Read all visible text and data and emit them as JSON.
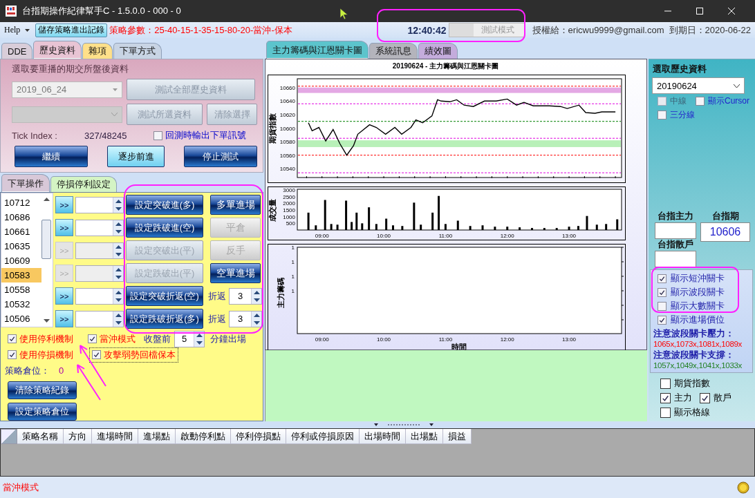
{
  "window": {
    "title": "台指期操作紀律幫手C - 1.5.0.0 - 000 - 0"
  },
  "toolbar": {
    "help_menu": "Help",
    "save_button": "儲存策略進出記錄",
    "strategy_params": "策略參數：25-40-15-1-35-15-80-20-當沖-保本",
    "clock": "12:40:42",
    "mode_button": "測試模式",
    "license": "授權給：ericwu9999@gmail.com",
    "expiry": "到期日：2020-06-22"
  },
  "left_tabs": [
    {
      "label": "DDE",
      "selected": false,
      "color": "#d9cdd9"
    },
    {
      "label": "歷史資料",
      "selected": true,
      "color": "#e8c4d4"
    },
    {
      "label": "雜項",
      "selected": false,
      "color": "#ffe08a"
    },
    {
      "label": "下單方式",
      "selected": false,
      "color": "#c8d4e4"
    }
  ],
  "history_panel": {
    "heading": "選取要重播的期交所盤後資料",
    "date_select": {
      "value": "2019_06_24",
      "disabled": true
    },
    "second_select": {
      "disabled": true
    },
    "buttons": [
      {
        "label": "測試全部歷史資料",
        "disabled": true
      },
      {
        "label": "測試所選資料",
        "disabled": true
      },
      {
        "label": "清除選擇",
        "disabled": true
      }
    ],
    "tick_index_label": "Tick Index :",
    "tick_index_value": "327/48245",
    "output_signal": {
      "label": "回測時輸出下單訊號",
      "checked": false
    },
    "actions": [
      {
        "label": "繼續",
        "kind": "dark"
      },
      {
        "label": "逐步前進",
        "kind": "light"
      },
      {
        "label": "停止測試",
        "kind": "dark"
      }
    ]
  },
  "order_tabs": [
    {
      "label": "下單操作",
      "selected": true,
      "color": "#d8c8d8"
    },
    {
      "label": "停損停利設定",
      "selected": false,
      "color": "#d4f4c4"
    }
  ],
  "price_list": [
    {
      "label": "10712",
      "selected": false
    },
    {
      "label": "10686",
      "selected": false
    },
    {
      "label": "10661",
      "selected": false
    },
    {
      "label": "10635",
      "selected": false
    },
    {
      "label": "10609",
      "selected": false
    },
    {
      "label": "10583",
      "selected": true
    },
    {
      "label": "10558",
      "selected": false
    },
    {
      "label": "10532",
      "selected": false
    },
    {
      "label": "10506",
      "selected": false
    }
  ],
  "order_rows": [
    {
      "arrow": ">>",
      "enabled": true,
      "action": {
        "label": "設定突破進(多)",
        "disabled": false
      },
      "side": {
        "kind": "button",
        "label": "多單進場",
        "disabled": false
      }
    },
    {
      "arrow": ">>",
      "enabled": true,
      "action": {
        "label": "設定跌破進(空)",
        "disabled": false
      },
      "side": {
        "kind": "button",
        "label": "平倉",
        "disabled": true
      }
    },
    {
      "arrow": ">>",
      "enabled": false,
      "action": {
        "label": "設定突破出(平)",
        "disabled": true
      },
      "side": {
        "kind": "button",
        "label": "反手",
        "disabled": true
      }
    },
    {
      "arrow": ">>",
      "enabled": false,
      "action": {
        "label": "設定跌破出(平)",
        "disabled": true
      },
      "side": {
        "kind": "button",
        "label": "空單進場",
        "disabled": false
      }
    },
    {
      "arrow": ">>",
      "enabled": true,
      "action": {
        "label": "設定突破折返(空)",
        "disabled": false
      },
      "side": {
        "kind": "spin",
        "label": "折返",
        "value": "3"
      }
    },
    {
      "arrow": ">>",
      "enabled": true,
      "action": {
        "label": "設定跌破折返(多)",
        "disabled": false
      },
      "side": {
        "kind": "spin",
        "label": "折返",
        "value": "3"
      }
    }
  ],
  "options": [
    {
      "label": "使用停利機制",
      "checked": true
    },
    {
      "label": "當沖模式",
      "checked": true
    },
    {
      "label": "使用停損機制",
      "checked": true
    },
    {
      "label": "攻擊弱勢回檔保本",
      "checked": true
    }
  ],
  "close_exit": {
    "before": "收盤前",
    "value": "5",
    "after": "分鐘出場"
  },
  "position": {
    "label": "策略倉位：",
    "value": "0"
  },
  "strategy_buttons": [
    "清除策略紀錄",
    "設定策略倉位"
  ],
  "chart_tabs": [
    {
      "label": "主力籌碼與江恩關卡圖",
      "selected": true,
      "color": "#5cc4cc"
    },
    {
      "label": "系統訊息",
      "selected": false,
      "color": "#b4b4bc"
    },
    {
      "label": "績效圖",
      "selected": false,
      "color": "#c4acdc"
    }
  ],
  "chart_panel": {
    "title": "20190624 - 主力籌碼與江恩關卡圖",
    "price_chart": {
      "chart_data": {
        "type": "line",
        "ylabel": "期貨指數",
        "xlim": [
          8.6,
          13.85
        ],
        "ylim": [
          10525,
          10671
        ],
        "yticks": [
          10540,
          10560,
          10580,
          10600,
          10620,
          10640,
          10660
        ],
        "x": [
          8.78,
          8.84,
          8.95,
          9.06,
          9.18,
          9.29,
          9.4,
          9.51,
          9.58,
          9.77,
          9.88,
          10.03,
          10.18,
          10.29,
          10.44,
          10.52,
          10.63,
          10.78,
          10.87,
          10.93,
          11.07,
          11.18,
          11.3,
          11.45,
          11.63,
          11.82,
          12.0,
          12.15,
          12.27,
          12.42,
          12.68,
          12.86,
          12.97,
          13.16,
          13.27,
          13.42,
          13.53,
          13.75
        ],
        "series": [
          {
            "color": "#000000",
            "values": [
              10606,
              10594,
              10599,
              10579,
              10596,
              10575,
              10558,
              10572,
              10589,
              10603,
              10599,
              10589,
              10599,
              10589,
              10599,
              10610,
              10606,
              10616,
              10640,
              10638,
              10637,
              10640,
              10632,
              10630,
              10638,
              10638,
              10641,
              10632,
              10636,
              10631,
              10631,
              10630,
              10627,
              10632,
              10621,
              10620,
              10622,
              10622
            ]
          }
        ],
        "bands": [
          {
            "axis": "y",
            "from": 10650,
            "to": 10658,
            "color": "#e4a8e4"
          },
          {
            "axis": "y",
            "from": 10570,
            "to": 10580,
            "color": "#b8f0b8"
          }
        ],
        "ref_lines": [
          {
            "axis": "y",
            "value": 10660,
            "color": "#ff0000"
          },
          {
            "axis": "y",
            "value": 10634,
            "color": "#e000e0"
          },
          {
            "axis": "y",
            "value": 10608,
            "color": "#008000"
          },
          {
            "axis": "y",
            "value": 10583,
            "color": "#e000e0"
          },
          {
            "axis": "y",
            "value": 10558,
            "color": "#ff0000"
          },
          {
            "axis": "y",
            "value": 10532,
            "color": "#e000e0"
          }
        ]
      }
    },
    "volume_chart": {
      "chart_data": {
        "type": "bar",
        "ylabel": "成交量",
        "xlim": [
          8.6,
          13.85
        ],
        "ylim": [
          0,
          3000
        ],
        "yticks": [
          500,
          1000,
          1500,
          2000,
          2500,
          3000
        ],
        "xticks": [
          {
            "value": 9,
            "label": "09:00"
          },
          {
            "value": 10,
            "label": "10:00"
          },
          {
            "value": 11,
            "label": "11:00"
          },
          {
            "value": 12,
            "label": "12:00"
          },
          {
            "value": 13,
            "label": "13:00"
          }
        ],
        "x": [
          8.78,
          8.9,
          9.05,
          9.15,
          9.25,
          9.39,
          9.48,
          9.56,
          9.65,
          9.76,
          9.88,
          10.04,
          10.15,
          10.3,
          10.49,
          10.6,
          10.79,
          10.89,
          11.0,
          11.2,
          11.4,
          11.6,
          11.8,
          12.0,
          12.2,
          12.4,
          12.6,
          12.8,
          13.0,
          13.15,
          13.29,
          13.45,
          13.6,
          13.78
        ],
        "values": [
          1300,
          350,
          2250,
          450,
          400,
          2200,
          600,
          1300,
          500,
          1700,
          450,
          850,
          350,
          300,
          2050,
          400,
          1300,
          2550,
          450,
          700,
          300,
          350,
          250,
          250,
          200,
          150,
          150,
          150,
          250,
          300,
          1050,
          400,
          450,
          800
        ]
      }
    },
    "chip_chart": {
      "ylabel": "主力籌碼",
      "xlabel": "時間",
      "yticks": [
        "1",
        "1",
        "1",
        "1"
      ],
      "xticks": [
        "09:00",
        "10:00",
        "11:00",
        "12:00",
        "13:00"
      ]
    }
  },
  "right_panel": {
    "history_label": "選取歷史資料",
    "history_value": "20190624",
    "line_options": [
      {
        "label": "中線",
        "checked": false,
        "disabled": true
      },
      {
        "label": "顯示Cursor",
        "checked": false,
        "disabled": false
      },
      {
        "label": "三分線",
        "checked": false,
        "disabled": false
      }
    ],
    "main_label": "台指主力",
    "futures_label": "台指期",
    "futures_value": "10606",
    "retail_label": "台指散戶",
    "barrier_options": [
      {
        "label": "顯示短沖關卡",
        "checked": true
      },
      {
        "label": "顯示波段關卡",
        "checked": true
      },
      {
        "label": "顯示大數關卡",
        "checked": false
      },
      {
        "label": "顯示進場價位",
        "checked": true
      }
    ],
    "pressure_label": "注意波段關卡壓力：",
    "pressure_values": "1065x,1073x,1081x,1089x",
    "support_label": "注意波段關卡支撐：",
    "support_values": "1057x,1049x,1041x,1033x",
    "series_options": [
      {
        "label": "期貨指數",
        "checked": false
      },
      {
        "label": "主力",
        "checked": true
      },
      {
        "label": "散戶",
        "checked": true
      },
      {
        "label": "顯示格線",
        "checked": false
      }
    ]
  },
  "grid": {
    "columns": [
      "策略名稱",
      "方向",
      "進場時間",
      "進場點",
      "啟動停利點",
      "停利停損點",
      "停利或停損原因",
      "出場時間",
      "出場點",
      "損益"
    ]
  },
  "status_bar": {
    "text": "當沖模式"
  }
}
